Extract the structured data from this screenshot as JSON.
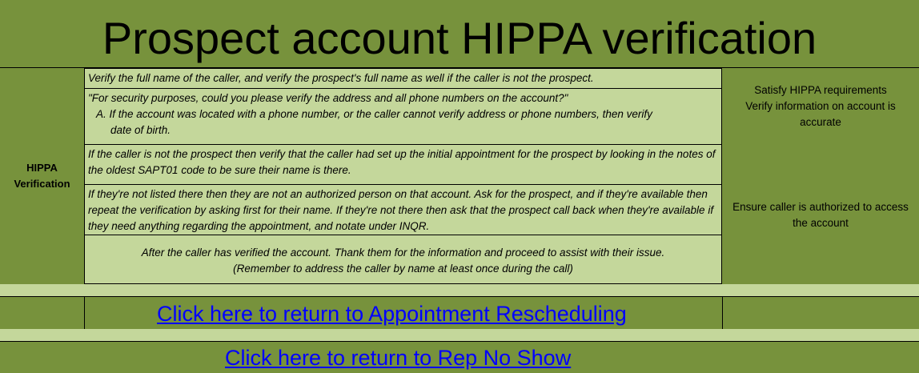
{
  "title": "Prospect account HIPPA verification",
  "row_label_line1": "HIPPA",
  "row_label_line2": "Verification",
  "steps": {
    "step1": "Verify the full name of the caller, and verify the prospect's full name as well if the caller is not the prospect.",
    "step2_line1": "\"For security purposes, could you please verify the address and all phone numbers on the account?\"",
    "step2_line2": "A.  If the account was located with a phone number, or the caller cannot verify address or phone numbers, then verify",
    "step2_line3": "date of birth.",
    "step3": "If the caller is not the prospect then verify that the caller had set up the initial appointment for the prospect by looking in the notes of the oldest SAPT01 code to be sure their name is there.",
    "step4": "If they're not listed there then they are not an authorized person on that account. Ask for the prospect, and if they're available then repeat the verification by asking first for their name. If they're not there then ask that the prospect call back when they're available if they need anything regarding the appointment, and notate under INQR.",
    "step5_line1": "After the caller has verified the account. Thank them for the information and proceed to assist with their issue.",
    "step5_line2": "(Remember to address the caller by name at least once during the call)"
  },
  "notes": {
    "purpose_line1": "Satisfy HIPPA requirements",
    "purpose_line2": "Verify information on account is",
    "purpose_line3": "accurate",
    "authorized_line1": "Ensure caller is authorized to access",
    "authorized_line2": "the account"
  },
  "links": {
    "appointment_rescheduling": "Click here to return to Appointment Rescheduling",
    "rep_no_show": "Click here to return to Rep No Show"
  },
  "colors": {
    "background": "#77923c",
    "cell": "#c4d79b",
    "link": "#0000ff"
  }
}
